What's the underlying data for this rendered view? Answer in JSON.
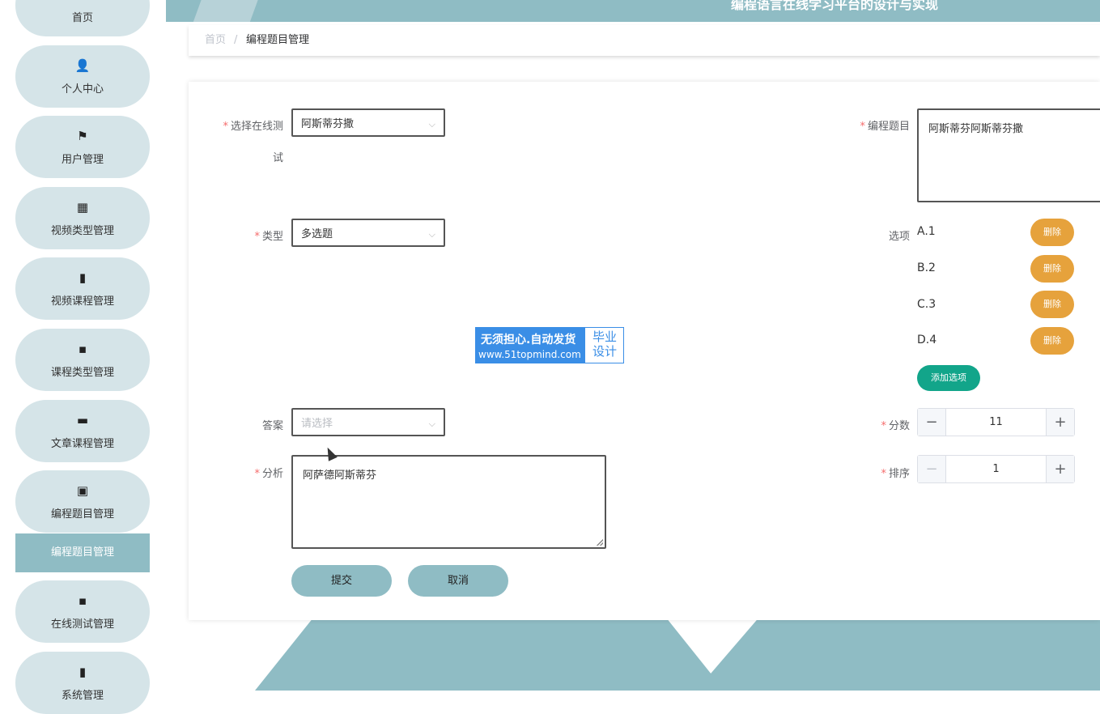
{
  "header": {
    "title": "编程语言在线学习平台的设计与实现"
  },
  "breadcrumb": {
    "home": "首页",
    "separator": "/",
    "current": "编程题目管理"
  },
  "sidebar": {
    "items": [
      {
        "label": "首页",
        "icon": "home-icon",
        "glyph": "⌂"
      },
      {
        "label": "个人中心",
        "icon": "user-icon",
        "glyph": "👤"
      },
      {
        "label": "用户管理",
        "icon": "flag-icon",
        "glyph": "⚑"
      },
      {
        "label": "视频类型管理",
        "icon": "grid-icon",
        "glyph": "▦"
      },
      {
        "label": "视频课程管理",
        "icon": "book-icon",
        "glyph": "▮"
      },
      {
        "label": "课程类型管理",
        "icon": "apps-icon",
        "glyph": "▪"
      },
      {
        "label": "文章课程管理",
        "icon": "briefcase-icon",
        "glyph": "▬"
      },
      {
        "label": "编程题目管理",
        "icon": "clipboard-icon",
        "glyph": "▣"
      },
      {
        "label": "在线测试管理",
        "icon": "apps-icon",
        "glyph": "▪"
      },
      {
        "label": "系统管理",
        "icon": "bar-chart-icon",
        "glyph": "▮"
      }
    ],
    "active_sub": "编程题目管理"
  },
  "form": {
    "exam_label_line1": "选择在线测",
    "exam_label_line2": "试",
    "exam_value": "阿斯蒂芬撒",
    "title_label": "编程题目",
    "title_value": "阿斯蒂芬阿斯蒂芬撒",
    "type_label": "类型",
    "type_value": "多选题",
    "options_label": "选项",
    "options": [
      "A.1",
      "B.2",
      "C.3",
      "D.4"
    ],
    "delete_label": "删除",
    "add_option_label": "添加选项",
    "answer_label": "答案",
    "answer_placeholder": "请选择",
    "score_label": "分数",
    "score_value": "11",
    "analysis_label": "分析",
    "analysis_value": "阿萨德阿斯蒂芬",
    "order_label": "排序",
    "order_value": "1",
    "submit_label": "提交",
    "cancel_label": "取消",
    "required_mark": "*",
    "minus": "−",
    "plus": "+",
    "arrow": "⌵"
  },
  "watermark": {
    "line1": "无须担心.自动发货",
    "line2": "www.51topmind.com",
    "right": "毕业设计"
  },
  "colors": {
    "accent": "#8fbcc4",
    "nav_bg": "#d5e4e8",
    "warning": "#e6a23c",
    "success": "#12a58a",
    "required": "#f56c6c"
  }
}
